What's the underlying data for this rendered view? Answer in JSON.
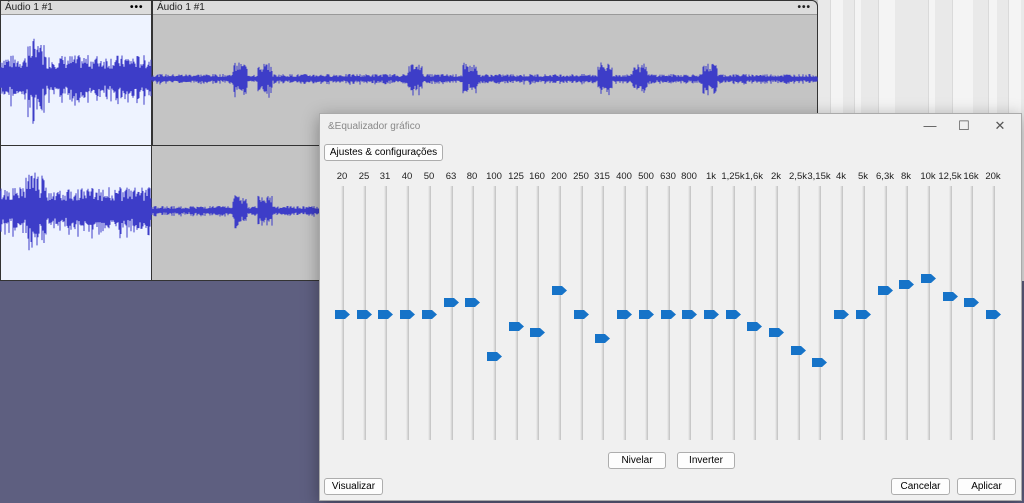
{
  "tracks": {
    "clip1_title": "Áudio 1 #1",
    "clip2_title": "Áudio 1 #1",
    "menu_glyph": "•••",
    "waveform_color": "#3d3dc8",
    "selection_color": "#eef3ff"
  },
  "dialog": {
    "title": "&Equalizador gráfico",
    "presets_button": "Ajustes & configurações",
    "level_button": "Nivelar",
    "invert_button": "Inverter",
    "preview_button": "Visualizar",
    "cancel_button": "Cancelar",
    "apply_button": "Aplicar",
    "minimize_glyph": "—",
    "maximize_glyph": "☐",
    "close_glyph": "✕",
    "thumb_color": "#1673c8",
    "bands": [
      {
        "label": "20",
        "gain": 0
      },
      {
        "label": "25",
        "gain": 0
      },
      {
        "label": "31",
        "gain": 0
      },
      {
        "label": "40",
        "gain": 0
      },
      {
        "label": "50",
        "gain": 0
      },
      {
        "label": "63",
        "gain": 1
      },
      {
        "label": "80",
        "gain": 1
      },
      {
        "label": "100",
        "gain": -3.5
      },
      {
        "label": "125",
        "gain": -1
      },
      {
        "label": "160",
        "gain": -1.5
      },
      {
        "label": "200",
        "gain": 2
      },
      {
        "label": "250",
        "gain": 0
      },
      {
        "label": "315",
        "gain": -2
      },
      {
        "label": "400",
        "gain": 0
      },
      {
        "label": "500",
        "gain": 0
      },
      {
        "label": "630",
        "gain": 0
      },
      {
        "label": "800",
        "gain": 0
      },
      {
        "label": "1k",
        "gain": 0
      },
      {
        "label": "1,25k",
        "gain": 0
      },
      {
        "label": "1,6k",
        "gain": -1
      },
      {
        "label": "2k",
        "gain": -1.5
      },
      {
        "label": "2,5k",
        "gain": -3
      },
      {
        "label": "3,15k",
        "gain": -4
      },
      {
        "label": "4k",
        "gain": 0
      },
      {
        "label": "5k",
        "gain": 0
      },
      {
        "label": "6,3k",
        "gain": 2
      },
      {
        "label": "8k",
        "gain": 2.5
      },
      {
        "label": "10k",
        "gain": 3
      },
      {
        "label": "12,5k",
        "gain": 1.5
      },
      {
        "label": "16k",
        "gain": 1
      },
      {
        "label": "20k",
        "gain": 0
      }
    ]
  }
}
